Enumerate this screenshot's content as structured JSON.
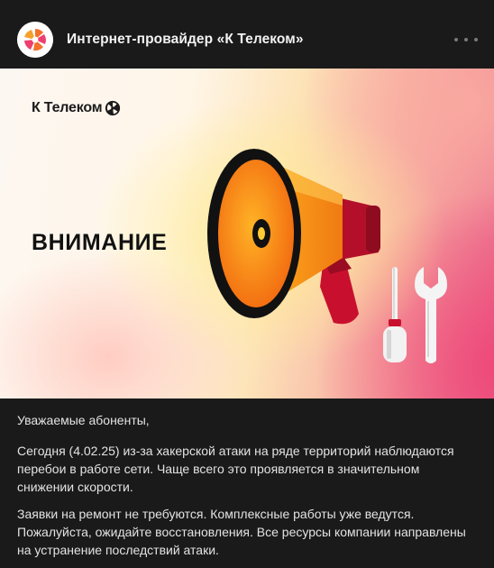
{
  "post": {
    "author": "Интернет-провайдер «К Телеком»",
    "more_icon": "more-dots-icon"
  },
  "banner": {
    "brand": "К Телеком",
    "headline": "ВНИМАНИЕ",
    "illustration": [
      "megaphone-icon",
      "screwdriver-icon",
      "wrench-icon"
    ]
  },
  "text": {
    "greeting": "Уважаемые абоненты,",
    "paragraph1": "Сегодня (4.02.25) из-за хакерской атаки на ряде территорий наблюдаются перебои в работе сети. Чаще всего это проявляется в значительном снижении скорости.",
    "paragraph2": "Заявки на ремонт не требуются. Комплексные работы уже ведутся. Пожалуйста, ожидайте восстановления. Все ресурсы компании направлены на устранение последствий атаки."
  },
  "colors": {
    "background": "#1a1a1a",
    "text": "#e3e3e3",
    "brand_orange": "#f5702a",
    "megaphone_red": "#c8102e"
  }
}
